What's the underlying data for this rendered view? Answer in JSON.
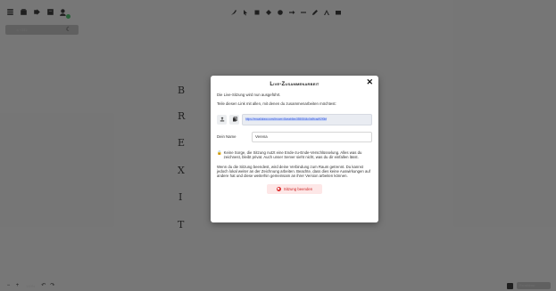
{
  "toolbar_left": {
    "icons": [
      "menu-icon",
      "library-icon",
      "export-icon",
      "share-icon",
      "live-collaboration-icon"
    ],
    "style_label": "☼ □□□",
    "collab_status_color": "#2bbd55"
  },
  "toolbar_center": {
    "tools": [
      "lock-icon",
      "selection-icon",
      "rectangle-icon",
      "diamond-icon",
      "ellipse-icon",
      "arrow-icon",
      "line-icon",
      "pencil-icon",
      "text-icon",
      "image-icon"
    ]
  },
  "canvas": {
    "letters": [
      "B",
      "R",
      "E",
      "X",
      "I",
      "T"
    ]
  },
  "modal": {
    "title": "Live-Zusammenarbeit",
    "intro": "Die Live-Sitzung wird nun ausgeführt.",
    "share_prompt": "Teile diesen Link mit allen, mit denen du zusammenarbeiten möchtest:",
    "link": "https://excalidraw.com/#room=8ceab6ec3550844c0a9fcad92f0bf",
    "name_label": "Dein Name",
    "name_value": "Verena",
    "privacy_note": "Keine Sorge, die Sitzung nutzt eine Ende-zu-Ende-Verschlüsselung. Alles was du zeichnest, bleibt privat. Auch unser Server sieht nicht, was du dir einfallen lässt.",
    "end_note": "Wenn du die Sitzung beendest, wird deine Verbindung zum Raum getrennt. Du kannst jedoch lokal weiter an der Zeichnung arbeiten. Beachte, dass dies keine Auswirkungen auf andere hat und diese weiterhin gemeinsam an ihrer Version arbeiten können.",
    "end_button": "Sitzung beenden",
    "accent_color": "#d33333"
  },
  "bottom": {
    "zoom": "100%",
    "minus": "−",
    "plus": "+",
    "undo": "↶",
    "redo": "↷",
    "right_label": "Excalidraw"
  }
}
